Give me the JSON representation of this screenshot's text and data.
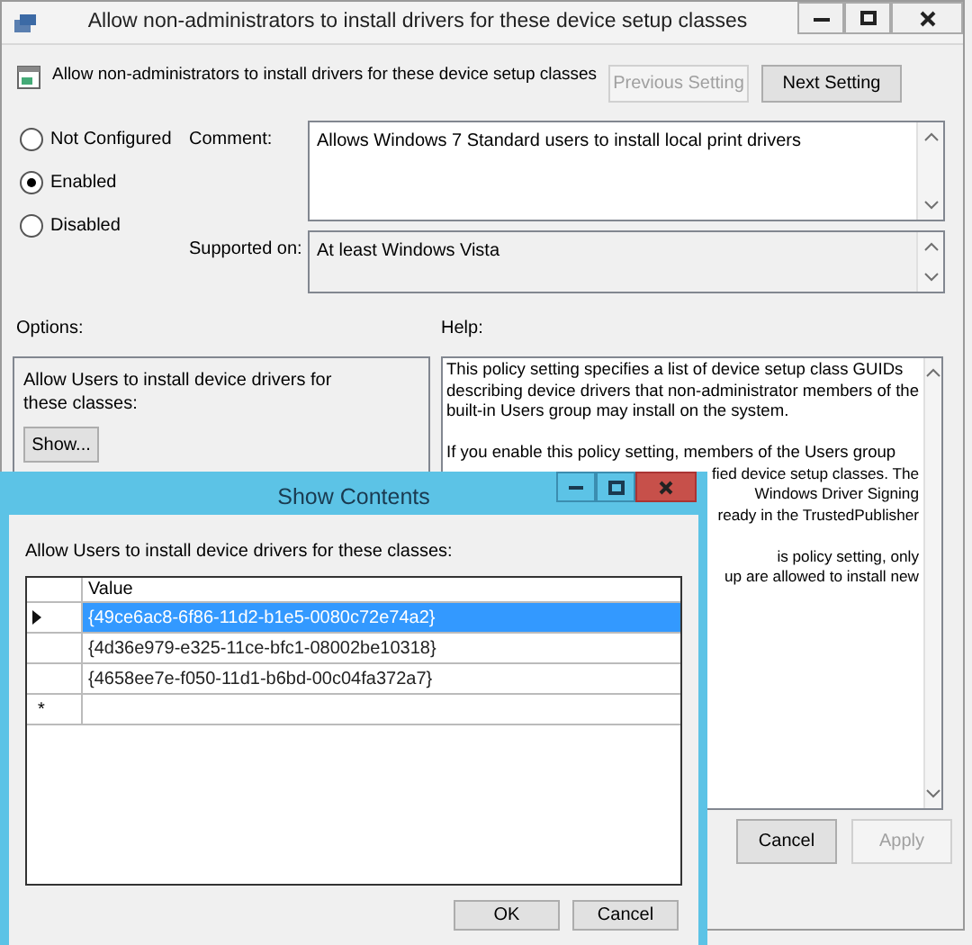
{
  "window": {
    "title": "Allow non-administrators to install drivers for these device setup classes",
    "policy_title": "Allow non-administrators to install drivers for these device setup classes",
    "nav_buttons": [
      {
        "label": "Previous Setting",
        "disabled": true
      },
      {
        "label": "Next Setting",
        "disabled": false
      }
    ]
  },
  "state_options": [
    {
      "label": "Not Configured",
      "selected": false
    },
    {
      "label": "Enabled",
      "selected": true
    },
    {
      "label": "Disabled",
      "selected": false
    }
  ],
  "comment": {
    "label": "Comment:",
    "value": "Allows Windows 7 Standard users to install local print drivers"
  },
  "supported_on": {
    "label": "Supported on:",
    "value": "At least Windows Vista"
  },
  "options": {
    "label": "Options:",
    "text": "Allow Users to install device drivers for these classes:",
    "button": "Show..."
  },
  "help": {
    "label": "Help:",
    "paragraphs": [
      {
        "lines": [
          {
            "text": "This policy setting specifies a list of device setup class GUIDs",
            "kind": "full"
          },
          {
            "text": "describing device drivers that non-administrator members of the",
            "kind": "full"
          },
          {
            "text": "built-in Users group may install on the system.",
            "kind": "full"
          }
        ]
      },
      {
        "lines": [
          {
            "text": "If you enable this policy setting, members of the Users group",
            "kind": "full"
          },
          {
            "text": "fied device setup classes. The",
            "kind": "cut"
          },
          {
            "text": "Windows Driver Signing",
            "kind": "cut"
          },
          {
            "text": "ready in the TrustedPublisher",
            "kind": "cut"
          }
        ]
      },
      {
        "lines": [
          {
            "text": "is policy setting, only",
            "kind": "cut"
          },
          {
            "text": "up are allowed to install new",
            "kind": "cut"
          }
        ]
      }
    ]
  },
  "footer_buttons": [
    {
      "label": "Cancel",
      "disabled": false
    },
    {
      "label": "Apply",
      "disabled": true
    }
  ],
  "dialog": {
    "title": "Show Contents",
    "prompt": "Allow Users to install device drivers for these classes:",
    "column": "Value",
    "new_row_marker": "*",
    "rows": [
      {
        "value": "{49ce6ac8-6f86-11d2-b1e5-0080c72e74a2}",
        "selected": true
      },
      {
        "value": "{4d36e979-e325-11ce-bfc1-08002be10318}",
        "selected": false
      },
      {
        "value": "{4658ee7e-f050-11d1-b6bd-00c04fa372a7}",
        "selected": false
      }
    ],
    "buttons": [
      {
        "label": "OK"
      },
      {
        "label": "Cancel"
      }
    ]
  }
}
